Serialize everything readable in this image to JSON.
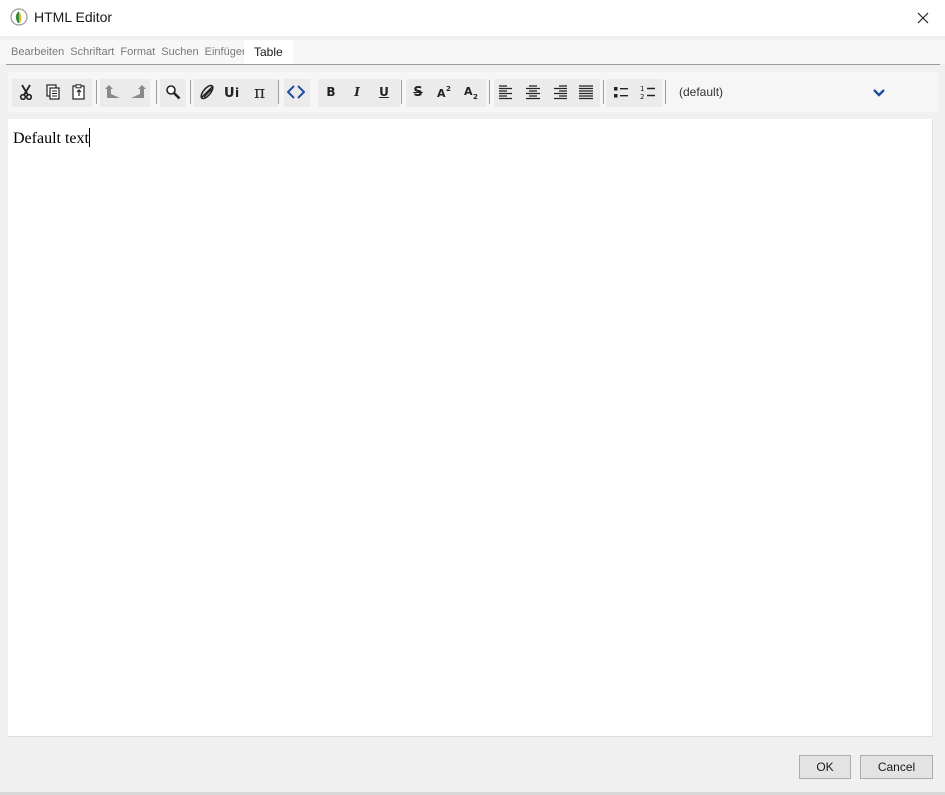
{
  "window": {
    "title": "HTML Editor",
    "app_icon": "leaf-app-icon",
    "close_icon": "close-x-icon"
  },
  "menubar": {
    "items": [
      "Bearbeiten",
      "Schriftart",
      "Format",
      "Suchen",
      "Einfügen"
    ],
    "active_tab": "Table"
  },
  "toolbar": {
    "buttons": [
      {
        "name": "cut",
        "icon": "scissors-icon"
      },
      {
        "name": "copy",
        "icon": "copy-icon"
      },
      {
        "name": "paste",
        "icon": "paste-icon"
      },
      {
        "name": "undo",
        "icon": "undo-arrow-icon"
      },
      {
        "name": "redo",
        "icon": "redo-arrow-icon"
      },
      {
        "name": "find",
        "icon": "magnifier-icon"
      },
      {
        "name": "link",
        "icon": "link-icon"
      },
      {
        "name": "unicode",
        "icon": "unicode-icon"
      },
      {
        "name": "math",
        "icon": "pi-icon"
      },
      {
        "name": "source",
        "icon": "code-brackets-icon"
      },
      {
        "name": "bold",
        "label": "B"
      },
      {
        "name": "italic",
        "label": "I"
      },
      {
        "name": "underline",
        "label": "U"
      },
      {
        "name": "strikethrough",
        "label": "S"
      },
      {
        "name": "superscript",
        "icon": "superscript-icon"
      },
      {
        "name": "subscript",
        "icon": "subscript-icon"
      },
      {
        "name": "align-left",
        "icon": "align-left-icon"
      },
      {
        "name": "align-center",
        "icon": "align-center-icon"
      },
      {
        "name": "align-right",
        "icon": "align-right-icon"
      },
      {
        "name": "justify",
        "icon": "justify-icon"
      },
      {
        "name": "bullet-list",
        "icon": "bullet-list-icon"
      },
      {
        "name": "numbered-list",
        "icon": "numbered-list-icon"
      }
    ],
    "style_select": {
      "value": "(default)",
      "icon": "chevron-down-icon"
    }
  },
  "editor": {
    "content": "Default text"
  },
  "footer": {
    "ok_label": "OK",
    "cancel_label": "Cancel"
  },
  "colors": {
    "chevron": "#1f4f9e",
    "toolbar_bg": "#f6f6f6",
    "group_bg": "#ebebeb",
    "button_bg": "#e3e3e3"
  }
}
